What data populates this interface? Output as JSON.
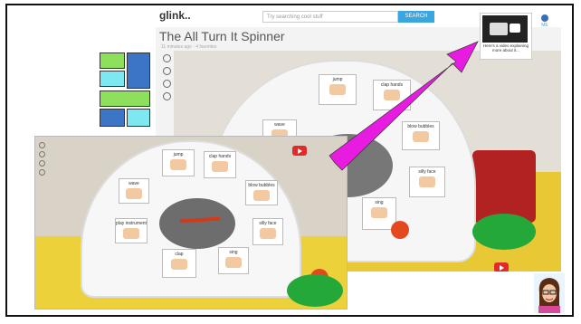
{
  "page": {
    "brand": "glink..",
    "search_placeholder": "Try searching cool stuff",
    "search_button": "SEARCH",
    "title": "The All Turn It Spinner",
    "meta": "11 minutes ago · 4 favorites",
    "account_label": "ME",
    "popup_caption": "Here's a video explaining more about it..."
  },
  "cards_big": [
    {
      "label": "jump"
    },
    {
      "label": "clap hands"
    },
    {
      "label": "wave"
    },
    {
      "label": "blow bubbles"
    },
    {
      "label": "silly face"
    },
    {
      "label": "sing"
    }
  ],
  "cards_small": [
    {
      "label": "jump"
    },
    {
      "label": "clap hands"
    },
    {
      "label": "wave"
    },
    {
      "label": "blow bubbles"
    },
    {
      "label": "silly face"
    },
    {
      "label": "sing"
    },
    {
      "label": "clap"
    },
    {
      "label": "play instrument"
    }
  ],
  "colors": {
    "arrow": "#e81ce0",
    "block_green": "#8ee05c",
    "block_blue": "#3c74c6",
    "block_cyan": "#7ee8f0",
    "search_btn": "#3aa6e0"
  }
}
